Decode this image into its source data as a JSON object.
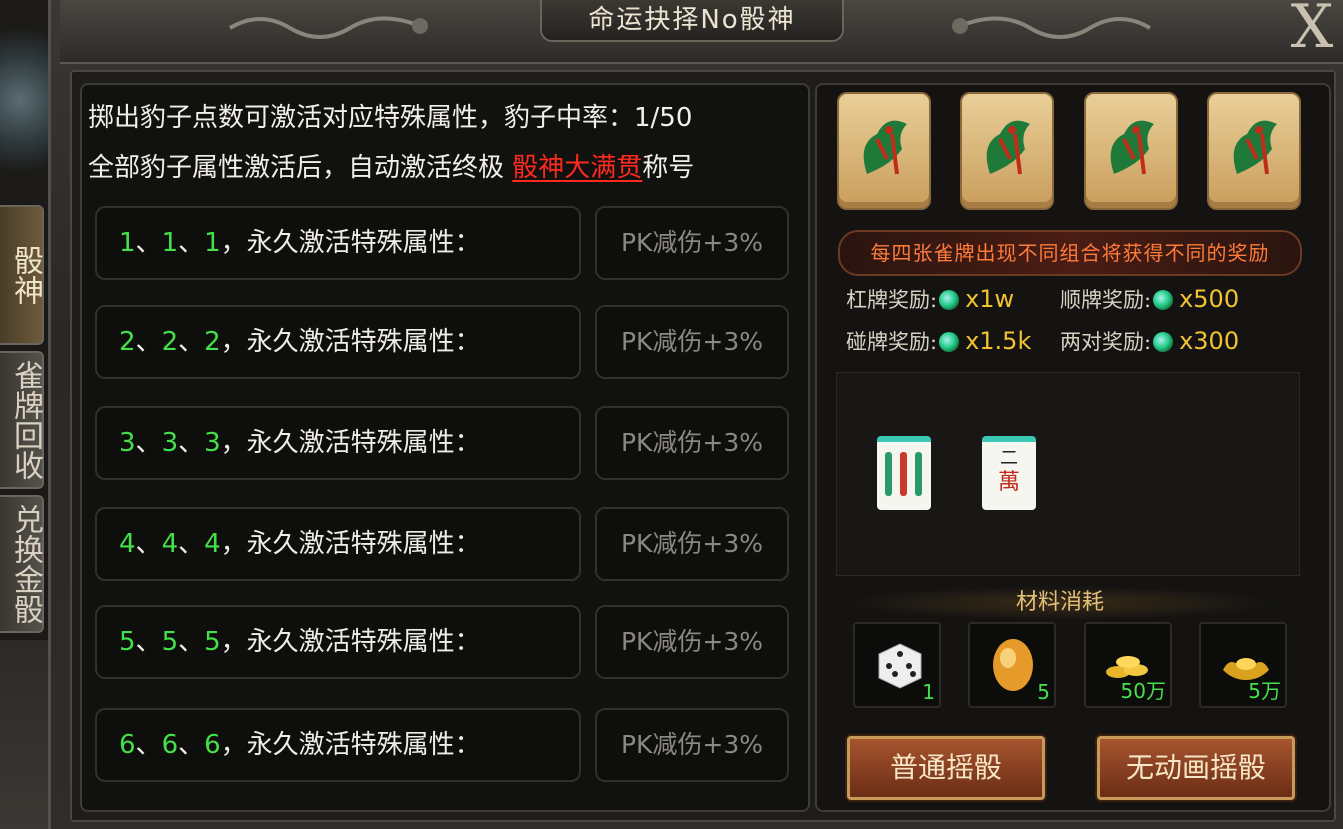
{
  "window": {
    "title": "命运抉择No骰神",
    "close_label": "X"
  },
  "side_tabs": [
    {
      "label": "骰神",
      "active": true
    },
    {
      "label": "雀牌回收",
      "active": false
    },
    {
      "label": "兑换金骰",
      "active": false
    }
  ],
  "description": {
    "line1": "掷出豹子点数可激活对应特殊属性，豹子中率：1/50",
    "line2_prefix": "全部豹子属性激活后，自动激活终极 ",
    "line2_highlight": "骰神大满贯",
    "line2_suffix": "称号"
  },
  "attributes": [
    {
      "d1": "1",
      "d2": "1",
      "d3": "1",
      "suffix": "，永久激活特殊属性：",
      "value": "PK减伤+3%"
    },
    {
      "d1": "2",
      "d2": "2",
      "d3": "2",
      "suffix": "，永久激活特殊属性：",
      "value": "PK减伤+3%"
    },
    {
      "d1": "3",
      "d2": "3",
      "d3": "3",
      "suffix": "，永久激活特殊属性：",
      "value": "PK减伤+3%"
    },
    {
      "d1": "4",
      "d2": "4",
      "d3": "4",
      "suffix": "，永久激活特殊属性：",
      "value": "PK减伤+3%"
    },
    {
      "d1": "5",
      "d2": "5",
      "d3": "5",
      "suffix": "，永久激活特殊属性：",
      "value": "PK减伤+3%"
    },
    {
      "d1": "6",
      "d2": "6",
      "d3": "6",
      "suffix": "，永久激活特殊属性：",
      "value": "PK减伤+3%"
    }
  ],
  "separator": "、",
  "mahjong_info": "每四张雀牌出现不同组合将获得不同的奖励",
  "rewards": {
    "gang_label": "杠牌奖励:",
    "gang_amount": "x1w",
    "shun_label": "顺牌奖励:",
    "shun_amount": "x500",
    "peng_label": "碰牌奖励:",
    "peng_amount": "x1.5k",
    "pair_label": "两对奖励:",
    "pair_amount": "x300"
  },
  "drawn_tiles": [
    {
      "name": "three-bamboo"
    },
    {
      "name": "two-characters",
      "text_top": "二",
      "text_bottom": "萬"
    }
  ],
  "materials": {
    "title": "材料消耗",
    "items": [
      {
        "icon": "dice-icon",
        "count": "1"
      },
      {
        "icon": "amber-gem-icon",
        "count": "5"
      },
      {
        "icon": "gold-coins-icon",
        "count": "50万"
      },
      {
        "icon": "gold-ingot-icon",
        "count": "5万"
      }
    ]
  },
  "buttons": {
    "normal_roll": "普通摇骰",
    "no_anim_roll": "无动画摇骰"
  },
  "colors": {
    "highlight_red": "#ff2a1e",
    "dice_green": "#44e04a",
    "reward_gold": "#f1c232",
    "banner_orange": "#ff7b3a"
  }
}
